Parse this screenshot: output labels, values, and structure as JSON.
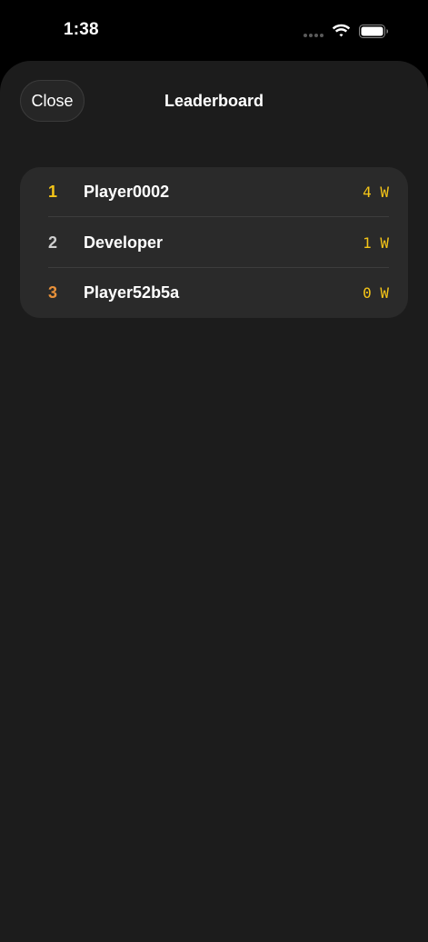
{
  "status_bar": {
    "time": "1:38"
  },
  "header": {
    "close_label": "Close",
    "title": "Leaderboard"
  },
  "leaderboard": [
    {
      "rank": "1",
      "name": "Player0002",
      "wins": "4 W",
      "rank_color": "#f5c518"
    },
    {
      "rank": "2",
      "name": "Developer",
      "wins": "1 W",
      "rank_color": "#cfcfcf"
    },
    {
      "rank": "3",
      "name": "Player52b5a",
      "wins": "0 W",
      "rank_color": "#e8913a"
    }
  ],
  "colors": {
    "background": "#1c1c1c",
    "card": "#2a2a2a",
    "wins_accent": "#f5c518"
  }
}
